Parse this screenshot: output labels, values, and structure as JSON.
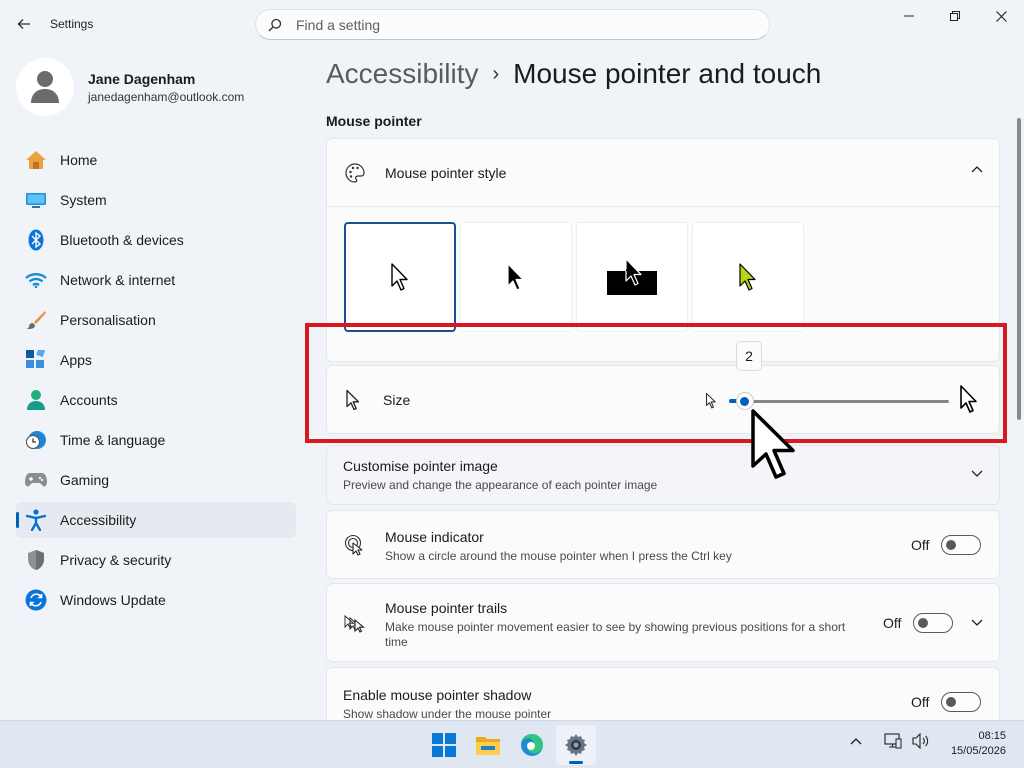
{
  "window": {
    "app_title": "Settings"
  },
  "search": {
    "placeholder": "Find a setting"
  },
  "profile": {
    "name": "Jane Dagenham",
    "email": "janedagenham@outlook.com"
  },
  "sidebar": {
    "items": [
      {
        "label": "Home",
        "icon": "home-icon"
      },
      {
        "label": "System",
        "icon": "system-icon"
      },
      {
        "label": "Bluetooth & devices",
        "icon": "bluetooth-icon"
      },
      {
        "label": "Network & internet",
        "icon": "wifi-icon"
      },
      {
        "label": "Personalisation",
        "icon": "brush-icon"
      },
      {
        "label": "Apps",
        "icon": "apps-icon"
      },
      {
        "label": "Accounts",
        "icon": "accounts-icon"
      },
      {
        "label": "Time & language",
        "icon": "clock-globe-icon"
      },
      {
        "label": "Gaming",
        "icon": "gamepad-icon"
      },
      {
        "label": "Accessibility",
        "icon": "accessibility-icon",
        "active": true
      },
      {
        "label": "Privacy & security",
        "icon": "shield-icon"
      },
      {
        "label": "Windows Update",
        "icon": "update-icon"
      }
    ]
  },
  "breadcrumb": {
    "parent": "Accessibility",
    "separator": "›",
    "current": "Mouse pointer and touch"
  },
  "main": {
    "section_title": "Mouse pointer",
    "pointer_style": {
      "label": "Mouse pointer style",
      "options": [
        "white",
        "black",
        "inverted",
        "custom"
      ],
      "selected": "white",
      "custom_color": "#b4d618"
    },
    "size": {
      "label": "Size",
      "value": "2",
      "min": 1,
      "max": 15
    },
    "customise": {
      "title": "Customise pointer image",
      "desc": "Preview and change the appearance of each pointer image"
    },
    "indicator": {
      "title": "Mouse indicator",
      "desc": "Show a circle around the mouse pointer when I press the Ctrl key",
      "state": "Off"
    },
    "trails": {
      "title": "Mouse pointer trails",
      "desc": "Make mouse pointer movement easier to see by showing previous positions for a short time",
      "state": "Off"
    },
    "shadow": {
      "title": "Enable mouse pointer shadow",
      "desc": "Show shadow under the mouse pointer",
      "state": "Off"
    }
  },
  "taskbar": {
    "apps": [
      "start-icon",
      "file-explorer-icon",
      "edge-icon",
      "settings-icon"
    ],
    "time": "08:15",
    "date": "15/05/2026"
  },
  "colors": {
    "accent": "#005fb8",
    "highlight": "#d71920"
  }
}
